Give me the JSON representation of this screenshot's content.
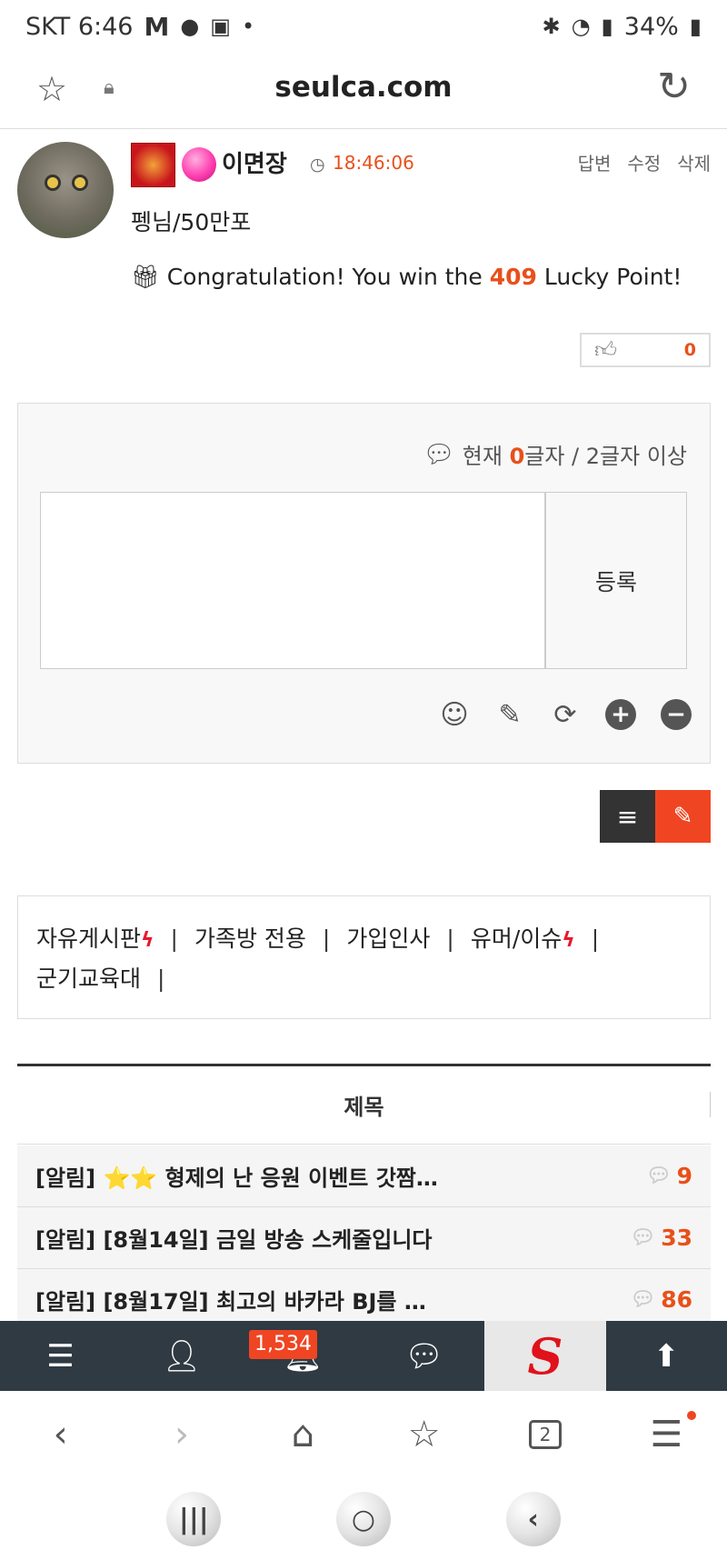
{
  "status_bar": {
    "carrier_time": "SKT 6:46",
    "m_icon": "M",
    "battery": "34%"
  },
  "url_bar": {
    "domain": "seulca.com"
  },
  "post": {
    "author": "이면장",
    "time": "18:46:06",
    "actions": [
      "답변",
      "수정",
      "삭제"
    ],
    "subtitle": "펭님/50만포",
    "lucky_prefix": "Congratulation! You win the ",
    "lucky_points": "409",
    "lucky_suffix": " Lucky Point!",
    "likes": "0"
  },
  "comment": {
    "count_prefix": "현재 ",
    "count_value": "0",
    "count_suffix": "글자 / 2글자 이상",
    "submit_label": "등록",
    "tools": [
      "smile-icon",
      "pencil-icon",
      "refresh-icon",
      "plus-icon",
      "minus-icon"
    ]
  },
  "categories": [
    {
      "label": "자유게시판",
      "hot": true
    },
    {
      "label": "가족방 전용",
      "hot": false
    },
    {
      "label": "가입인사",
      "hot": false
    },
    {
      "label": "유머/이슈",
      "hot": true
    },
    {
      "label": "군기교육대",
      "hot": false
    }
  ],
  "board": {
    "header": "제목",
    "rows": [
      {
        "prefix": "[알림] ",
        "stars": "⭐⭐",
        "title": " 형제의 난 응원 이벤트 갓짬…",
        "comments": "9"
      },
      {
        "prefix": "[알림] ",
        "stars": "",
        "title": "[8월14일] 금일 방송 스케줄입니다",
        "comments": "33"
      },
      {
        "prefix": "[알림] ",
        "stars": "",
        "title": "[8월17일] 최고의 바카라 BJ를 …",
        "comments": "86"
      }
    ]
  },
  "site_nav": {
    "notification_count": "1,534",
    "items": [
      "menu-icon",
      "user-icon",
      "bell-icon",
      "chat-icon",
      "logo",
      "arrow-up-icon"
    ],
    "logo_text": "S"
  },
  "browser_nav": {
    "tab_count": "2"
  },
  "colors": {
    "accent": "#e8501a",
    "nav_bg": "#2f3a43",
    "write_btn": "#f04522"
  }
}
